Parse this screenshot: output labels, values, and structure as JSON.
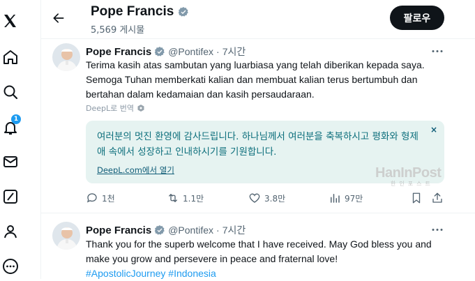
{
  "nav": {
    "items": [
      "x-logo-icon",
      "home-icon",
      "search-icon",
      "notifications-icon",
      "messages-icon",
      "grok-icon",
      "profile-icon",
      "more-icon"
    ],
    "notification_count": "1"
  },
  "header": {
    "name": "Pope Francis",
    "post_count": "5,569 게시물",
    "follow_label": "팔로우"
  },
  "tweets": [
    {
      "name": "Pope Francis",
      "handle": "@Pontifex",
      "dot": "·",
      "time": "7시간",
      "text": "Terima kasih atas sambutan yang luarbiasa yang telah diberikan kepada saya. Semoga Tuhan memberkati kalian dan membuat kalian terus bertumbuh dan bertahan dalam kedamaian dan kasih persaudaraan.",
      "translate_label": "DeepL로 번역",
      "translation": {
        "text": "여러분의 멋진 환영에 감사드립니다. 하나님께서 여러분을 축복하시고 평화와 형제애 속에서 성장하고 인내하시기를 기원합니다.",
        "open_link": "DeepL.com에서 열기",
        "close": "×"
      },
      "actions": {
        "replies": "1천",
        "retweets": "1.1만",
        "likes": "3.8만",
        "views": "97만"
      }
    },
    {
      "name": "Pope Francis",
      "handle": "@Pontifex",
      "dot": "·",
      "time": "7시간",
      "text": "Thank you for the superb welcome that I have received. May God bless you and make you grow and persevere in peace and fraternal love!",
      "hashtags": [
        "#ApostolicJourney",
        "#Indonesia"
      ]
    }
  ],
  "watermark": {
    "main": "HanInPost",
    "sub": "한인포스트"
  },
  "colors": {
    "accent": "#1d9bf0",
    "translation_bg": "#e6f3f1",
    "translation_text": "#0d6f7c"
  }
}
